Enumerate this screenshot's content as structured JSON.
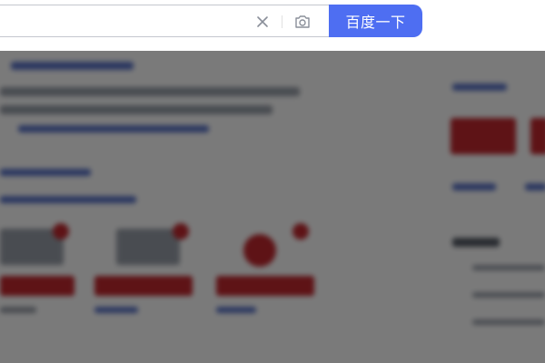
{
  "search": {
    "value": "",
    "button_label": "百度一下"
  },
  "icons": {
    "clear": "close-icon",
    "camera": "camera-icon"
  },
  "colors": {
    "button": "#4e6ef2",
    "overlay": "rgba(0,0,0,0.52)"
  }
}
